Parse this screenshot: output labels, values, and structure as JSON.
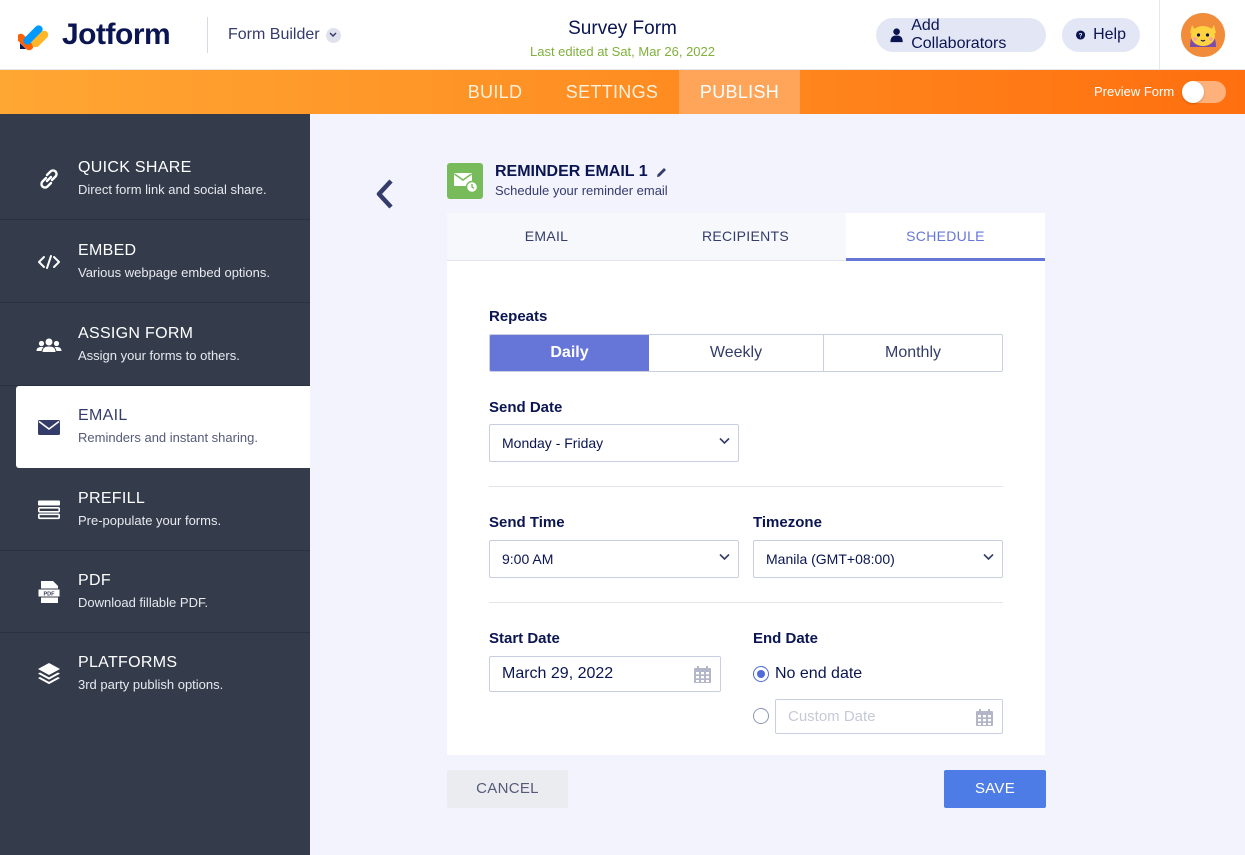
{
  "header": {
    "brand": "Jotform",
    "builder_label": "Form Builder",
    "form_title": "Survey Form",
    "last_edited": "Last edited at Sat, Mar 26, 2022",
    "collab_label": "Add Collaborators",
    "help_label": "Help"
  },
  "nav": {
    "tabs": [
      "BUILD",
      "SETTINGS",
      "PUBLISH"
    ],
    "active_tab": "PUBLISH",
    "preview_label": "Preview Form",
    "preview_on": false
  },
  "sidebar": {
    "items": [
      {
        "label": "QUICK SHARE",
        "desc": "Direct form link and social share.",
        "icon": "link-icon"
      },
      {
        "label": "EMBED",
        "desc": "Various webpage embed options.",
        "icon": "code-icon"
      },
      {
        "label": "ASSIGN FORM",
        "desc": "Assign your forms to others.",
        "icon": "users-icon"
      },
      {
        "label": "EMAIL",
        "desc": "Reminders and instant sharing.",
        "icon": "envelope-icon"
      },
      {
        "label": "PREFILL",
        "desc": "Pre-populate your forms.",
        "icon": "prefill-icon"
      },
      {
        "label": "PDF",
        "desc": "Download fillable PDF.",
        "icon": "pdf-icon"
      },
      {
        "label": "PLATFORMS",
        "desc": "3rd party publish options.",
        "icon": "layers-icon"
      }
    ],
    "active_index": 3
  },
  "panel": {
    "title": "REMINDER EMAIL 1",
    "subtitle": "Schedule your reminder email",
    "tabs": [
      "EMAIL",
      "RECIPIENTS",
      "SCHEDULE"
    ],
    "active_tab": "SCHEDULE"
  },
  "schedule": {
    "repeats_label": "Repeats",
    "repeat_options": [
      "Daily",
      "Weekly",
      "Monthly"
    ],
    "repeat_selected": "Daily",
    "send_date_label": "Send Date",
    "send_date_value": "Monday - Friday",
    "send_time_label": "Send Time",
    "send_time_value": "9:00 AM",
    "timezone_label": "Timezone",
    "timezone_value": "Manila (GMT+08:00)",
    "start_date_label": "Start Date",
    "start_date_value": "March 29, 2022",
    "end_date_label": "End Date",
    "end_option_none": "No end date",
    "end_option_custom_placeholder": "Custom Date",
    "end_selected": "No end date"
  },
  "footer": {
    "cancel_label": "CANCEL",
    "save_label": "SAVE"
  },
  "colors": {
    "accent": "#6576d8",
    "save": "#4e7ce6",
    "nav_orange": "#ff8e22",
    "sidebar_bg": "#343c4c",
    "edited_green": "#7fb03b"
  }
}
